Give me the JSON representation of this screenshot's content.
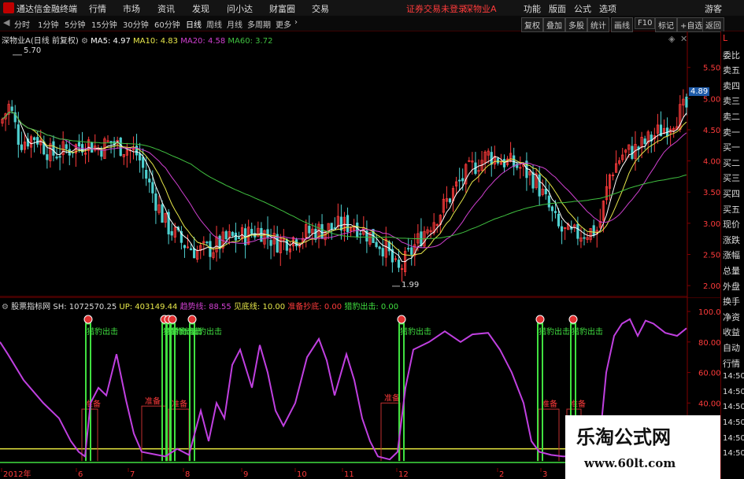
{
  "titlebar": {
    "app_title": "通达信金融终端",
    "menu": [
      "行情",
      "市场",
      "资讯",
      "发现",
      "问小达",
      "财富圈",
      "交易"
    ],
    "alert": "证券交易未登录",
    "stock_name": "深物业A",
    "buttons": [
      "功能",
      "版面",
      "公式",
      "选项"
    ],
    "guest": "游客"
  },
  "toolbar": {
    "timeframes": [
      "分时",
      "1分钟",
      "5分钟",
      "15分钟",
      "30分钟",
      "60分钟",
      "日线",
      "周线",
      "月线",
      "多周期",
      "更多"
    ],
    "active_timeframe": "日线",
    "right_buttons": [
      "复权",
      "叠加",
      "多股",
      "统计",
      "画线",
      "F10",
      "标记",
      "+自选",
      "返回"
    ]
  },
  "main_legend": {
    "title": "深物业A(日线 前复权)",
    "ma5": "MA5: 4.97",
    "ma10": "MA10: 4.83",
    "ma20": "MA20: 4.58",
    "ma60": "MA60: 3.72",
    "high_label": "5.70",
    "low_label": "1.99",
    "last_price": "4.89"
  },
  "price_axis": [
    "5.50",
    "5.00",
    "4.50",
    "4.00",
    "3.50",
    "3.00",
    "2.50",
    "2.00"
  ],
  "indicator_legend": {
    "name": "股票指标网",
    "sh": "SH: 1072570.25",
    "up": "UP: 403149.44",
    "trend": "趋势线: 88.55",
    "bottom": "见底线: 10.00",
    "prepare": "准备抄底: 0.00",
    "hunt": "猎豹出击: 0.00"
  },
  "indicator_axis": [
    "100.00",
    "80.00",
    "60.00",
    "40.00",
    "20.00"
  ],
  "signal_labels": {
    "hunt": "猎豹出击",
    "prepare": "准备"
  },
  "time_axis": [
    "2012年",
    "6",
    "7",
    "8",
    "9",
    "10",
    "11",
    "12",
    "2",
    "3"
  ],
  "right_panel": [
    "L",
    "委比",
    "卖五",
    "卖四",
    "卖三",
    "卖二",
    "卖一",
    "买一",
    "买二",
    "买三",
    "买四",
    "买五",
    "现价",
    "涨跌",
    "涨幅",
    "总量",
    "外盘",
    "换手",
    "净资",
    "收益",
    "自动",
    "行情",
    "14:50",
    "14:50",
    "14:50",
    "14:50",
    "14:50",
    "14:50"
  ],
  "watermark": {
    "title": "乐淘公式网",
    "url": "www.60lt.com"
  },
  "colors": {
    "up": "#ff3b3b",
    "down": "#4fd1d1",
    "ma5": "#ffffff",
    "ma10": "#e8e84a",
    "ma20": "#d040d0",
    "ma60": "#40c040",
    "trend": "#c040e0",
    "signal": "#40e040",
    "bottom_line": "#e8e840"
  }
}
